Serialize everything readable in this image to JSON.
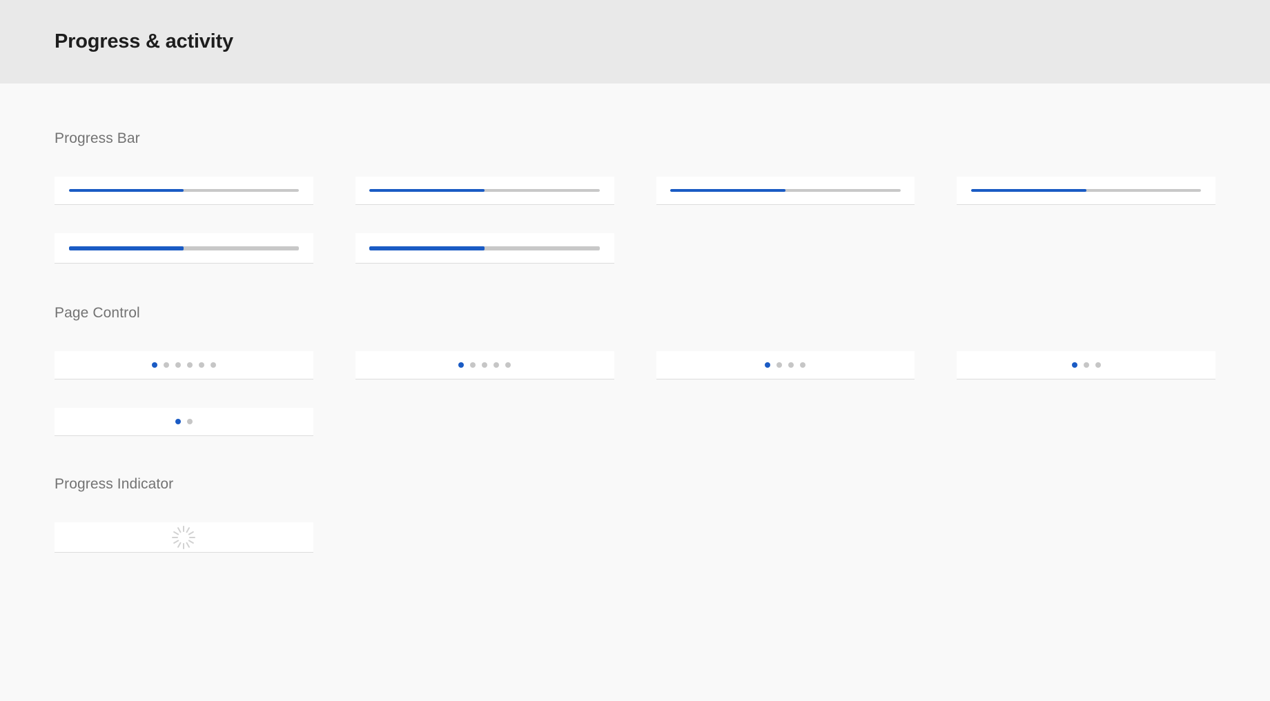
{
  "header": {
    "title": "Progress & activity"
  },
  "colors": {
    "accent": "#1a5bc4",
    "track": "#c8c8c8",
    "dot_inactive": "#c6c6c6",
    "spinner": "#d2d2d2",
    "header_band": "#e9e9e9",
    "page_background": "#f9f9f9",
    "card_background": "#ffffff",
    "card_border": "#dcdcdc",
    "section_title": "#737373",
    "header_title": "#1d1d1d"
  },
  "sections": [
    {
      "id": "progress-bar",
      "title": "Progress Bar",
      "rows": [
        {
          "items": [
            {
              "kind": "progressbar",
              "value": 50,
              "thickness": "thin"
            },
            {
              "kind": "progressbar",
              "value": 50,
              "thickness": "thin"
            },
            {
              "kind": "progressbar",
              "value": 50,
              "thickness": "thin"
            },
            {
              "kind": "progressbar",
              "value": 50,
              "thickness": "thin"
            }
          ]
        },
        {
          "items": [
            {
              "kind": "progressbar",
              "value": 50,
              "thickness": "thick"
            },
            {
              "kind": "progressbar",
              "value": 50,
              "thickness": "thick"
            },
            {
              "kind": "empty"
            },
            {
              "kind": "empty"
            }
          ]
        }
      ]
    },
    {
      "id": "page-control",
      "title": "Page Control",
      "rows": [
        {
          "items": [
            {
              "kind": "pagecontrol",
              "count": 6,
              "active": 0
            },
            {
              "kind": "pagecontrol",
              "count": 5,
              "active": 0
            },
            {
              "kind": "pagecontrol",
              "count": 4,
              "active": 0
            },
            {
              "kind": "pagecontrol",
              "count": 3,
              "active": 0
            }
          ]
        },
        {
          "items": [
            {
              "kind": "pagecontrol",
              "count": 2,
              "active": 0
            },
            {
              "kind": "empty"
            },
            {
              "kind": "empty"
            },
            {
              "kind": "empty"
            }
          ]
        }
      ]
    },
    {
      "id": "progress-indicator",
      "title": "Progress Indicator",
      "rows": [
        {
          "items": [
            {
              "kind": "spinner",
              "spokes": 12
            },
            {
              "kind": "empty"
            },
            {
              "kind": "empty"
            },
            {
              "kind": "empty"
            }
          ]
        }
      ]
    }
  ]
}
